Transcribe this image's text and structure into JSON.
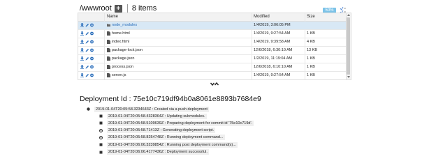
{
  "header": {
    "path": "/wwwroot",
    "item_count": "8 items",
    "percent_button": "50%"
  },
  "grid": {
    "columns": {
      "name": "Name",
      "modified": "Modified",
      "size": "Size"
    },
    "rows": [
      {
        "name": "node_modules",
        "modified": "1/4/2019, 3:06:05 PM",
        "size": "",
        "type": "folder",
        "selected": true
      },
      {
        "name": "home.html",
        "modified": "1/4/2019, 9:27:54 AM",
        "size": "1 KB",
        "type": "file"
      },
      {
        "name": "index.html",
        "modified": "1/4/2019, 9:39:58 AM",
        "size": "4 KB",
        "type": "file"
      },
      {
        "name": "package-lock.json",
        "modified": "12/6/2018, 6:30:10 AM",
        "size": "13 KB",
        "type": "file"
      },
      {
        "name": "package.json",
        "modified": "1/2/2019, 11:19:04 AM",
        "size": "1 KB",
        "type": "file"
      },
      {
        "name": "process.json",
        "modified": "12/6/2018, 6:10:10 AM",
        "size": "1 KB",
        "type": "file"
      },
      {
        "name": "server.js",
        "modified": "1/4/2019, 9:27:54 AM",
        "size": "1 KB",
        "type": "file"
      }
    ]
  },
  "deployment": {
    "title": "Deployment Id : 75e10c719df94b0a8061e8893b7684e9",
    "root": "2019-01-04T20:05:58.3234643Z : Created via a push deployment",
    "steps": [
      {
        "text": "2019-01-04T20:05:58.4328364Z : Updating submodules.",
        "icon": "square"
      },
      {
        "text": "2019-01-04T20:05:58.5109639Z : Preparing deployment for commit id '75e10c719d'.",
        "icon": "square"
      },
      {
        "text": "2019-01-04T20:05:58.71413Z : Generating deployment script.",
        "icon": "gear"
      },
      {
        "text": "2019-01-04T20:05:58.8254748Z : Running deployment command...",
        "icon": "gear"
      },
      {
        "text": "2019-01-04T20:06:06.3239854Z : Running post deployment command(s)...",
        "icon": "square"
      },
      {
        "text": "2019-01-04T20:06:06.4177436Z : Deployment successful.",
        "icon": "square"
      }
    ]
  },
  "colors": {
    "accent": "#2a6ebb",
    "selected_row": "#d8e8f5",
    "percent_button": "#7cc3e8"
  }
}
